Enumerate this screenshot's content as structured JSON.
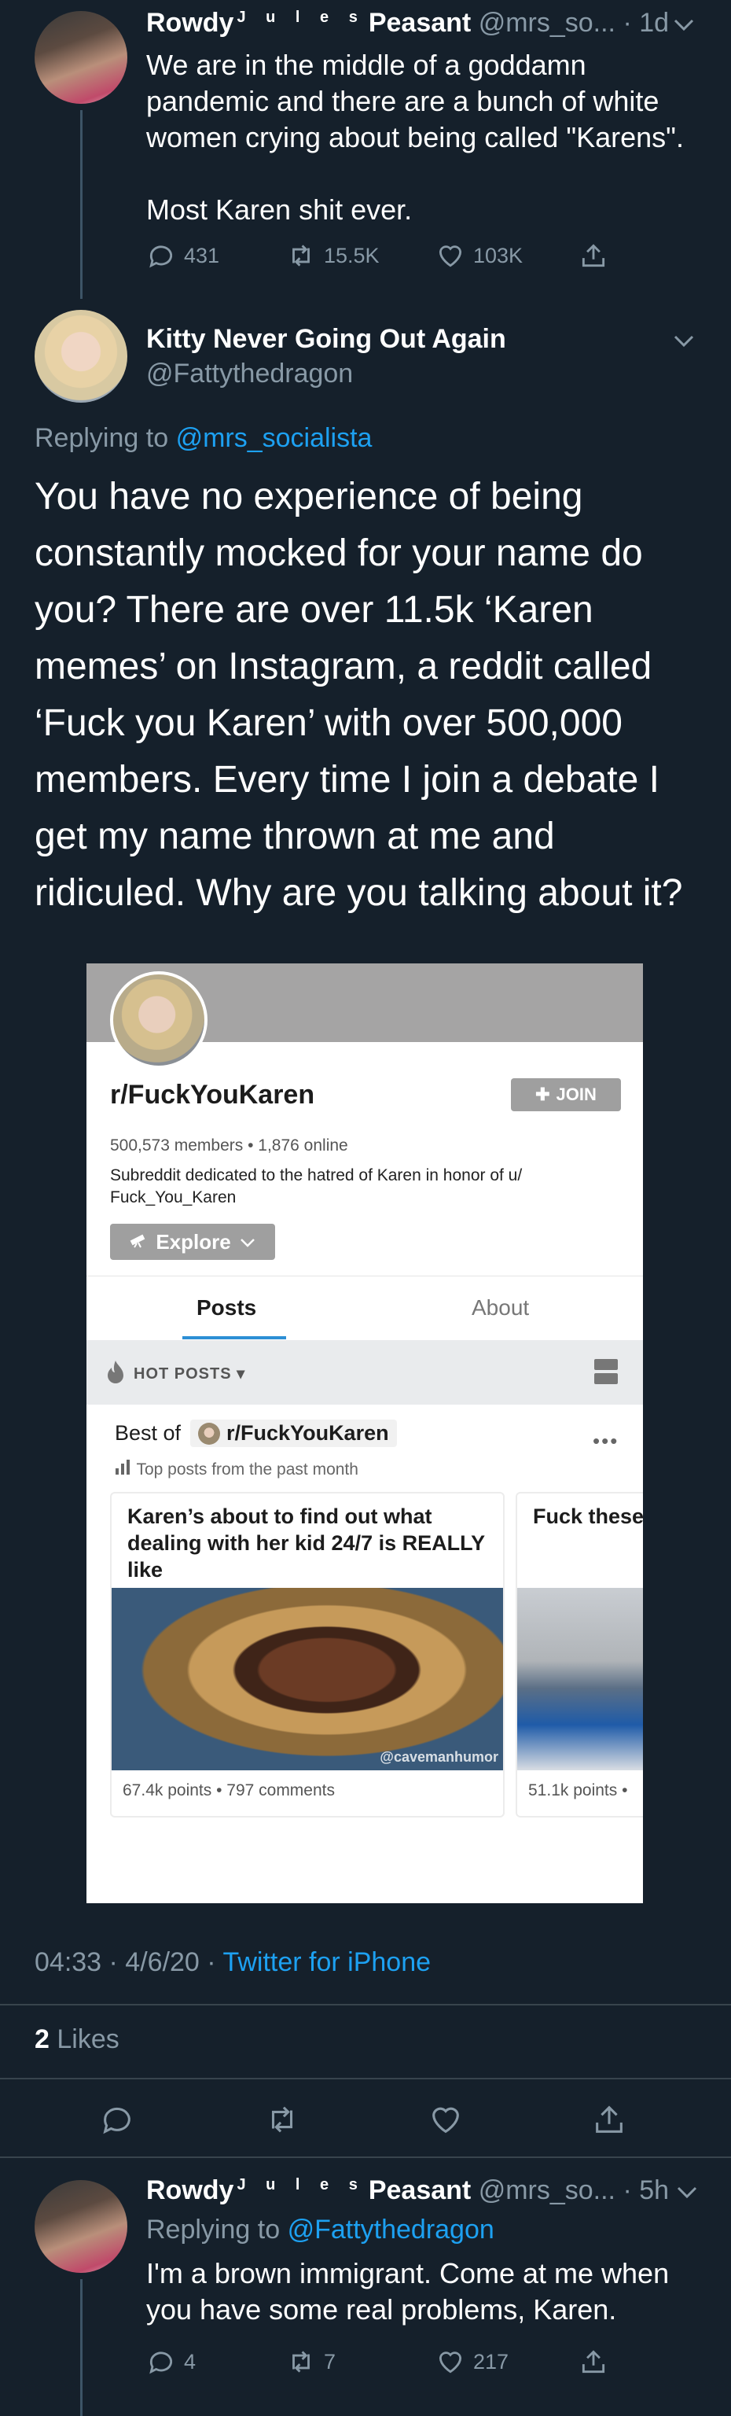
{
  "tweet1": {
    "name_first": "Rowdy",
    "name_middle": "J u l e s",
    "name_last": "Peasant",
    "handle": "@mrs_so...",
    "time": "· 1d",
    "text": "We are in the middle of a goddamn pandemic and there are a bunch of white women crying about being called \"Karens\".\n\nMost Karen shit ever.",
    "replies": "431",
    "retweets": "15.5K",
    "likes": "103K"
  },
  "main_tweet": {
    "name": "Kitty Never Going Out Again",
    "handle": "@Fattythedragon",
    "replying_prefix": "Replying to",
    "replying_handle": "@mrs_socialista",
    "text": "You have no experience of being constantly mocked for your name do you? There are over 11.5k ‘Karen memes’ on Instagram, a reddit called ‘Fuck you Karen’ with over 500,000 members. Every time I join a debate I get my name thrown at me and ridiculed. Why are you talking about it?",
    "timestamp": "04:33 · 4/6/20 ·",
    "source": "Twitter for iPhone",
    "likes_count": "2",
    "likes_label": "Likes"
  },
  "reddit": {
    "subreddit": "r/FuckYouKaren",
    "join_label": "JOIN",
    "stats": "500,573 members • 1,876 online",
    "description": "Subreddit dedicated to the hatred of Karen in honor of u/ Fuck_You_Karen",
    "explore_label": "Explore",
    "tab_posts": "Posts",
    "tab_about": "About",
    "hot_posts": "HOT POSTS",
    "best_of": "Best of",
    "best_sub": "r/FuckYouKaren",
    "top_posts": "Top posts from the past month",
    "post1": {
      "title": "Karen’s about to find out what dealing with her kid 24/7 is REALLY like",
      "watermark": "@cavemanhumor",
      "meta": "67.4k points • 797 comments"
    },
    "post2": {
      "title": "Fuck these",
      "meta": "51.1k points •"
    }
  },
  "reply": {
    "name_first": "Rowdy",
    "name_middle": "J u l e s",
    "name_last": "Peasant",
    "handle": "@mrs_so...",
    "time": "· 5h",
    "replying_prefix": "Replying to",
    "replying_handle": "@Fattythedragon",
    "text": "I'm a brown immigrant. Come at me when you have some real problems, Karen.",
    "replies": "4",
    "retweets": "7",
    "likes": "217"
  },
  "colors": {
    "background": "#15202b",
    "secondary_text": "#8899a6",
    "link": "#1da1f2",
    "divider": "#38444d"
  }
}
